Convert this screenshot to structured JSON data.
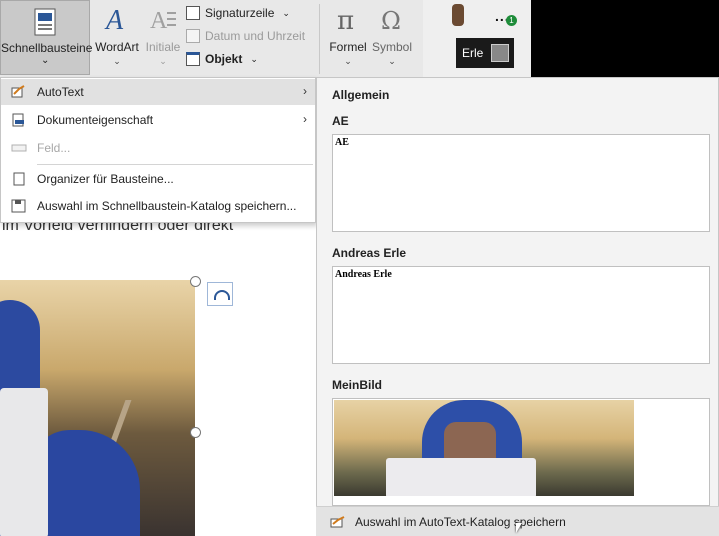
{
  "ribbon": {
    "schnellbausteine": "Schnellbausteine",
    "wordart": "WordArt",
    "initiale": "Initiale",
    "signaturzeile": "Signaturzeile",
    "datum_uhrzeit": "Datum und Uhrzeit",
    "objekt": "Objekt",
    "formel": "Formel",
    "symbol": "Symbol",
    "caret": "⌄",
    "small_caret": "⌄"
  },
  "account": {
    "name": "Erle",
    "dots": "...",
    "notification_count": "1"
  },
  "document": {
    "visible_text": "im Vorfeld verhindern oder direkt"
  },
  "menu": {
    "items": [
      {
        "label": "AutoText",
        "has_submenu": true,
        "highlighted": true
      },
      {
        "label": "Dokumenteigenschaft",
        "has_submenu": true
      },
      {
        "label": "Feld...",
        "disabled": true
      },
      {
        "label": "Organizer für Bausteine..."
      },
      {
        "label": "Auswahl im Schnellbaustein-Katalog speichern..."
      }
    ],
    "arrow": "›"
  },
  "autotext_panel": {
    "header": "Allgemein",
    "entries": [
      {
        "name": "AE",
        "preview": "AE"
      },
      {
        "name": "Andreas Erle",
        "preview": "Andreas Erle"
      },
      {
        "name": "MeinBild",
        "preview": ""
      }
    ],
    "footer": "Auswahl im AutoText-Katalog speichern"
  },
  "colors": {
    "accent_blue": "#2b5797",
    "menu_highlight": "#e1e1e1",
    "ribbon_bg": "#e8e8e8"
  }
}
